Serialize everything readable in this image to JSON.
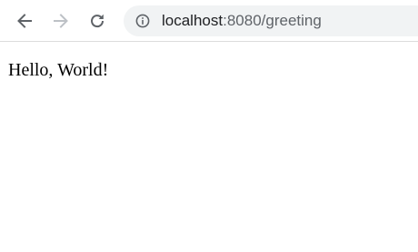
{
  "browser": {
    "toolbar": {
      "back_icon": "arrow-left-icon",
      "forward_icon": "arrow-right-icon",
      "forward_disabled": true,
      "reload_icon": "reload-icon",
      "site_info_icon": "info-circle-icon"
    },
    "address_bar": {
      "host": "localhost",
      "rest": ":8080/greeting"
    }
  },
  "page": {
    "body_text": "Hello, World!"
  },
  "colors": {
    "icon_active": "#5f6368",
    "icon_disabled": "#bdc1c6",
    "omnibox_bg": "#f1f3f4",
    "url_host": "#202124",
    "url_rest": "#5f6368"
  }
}
